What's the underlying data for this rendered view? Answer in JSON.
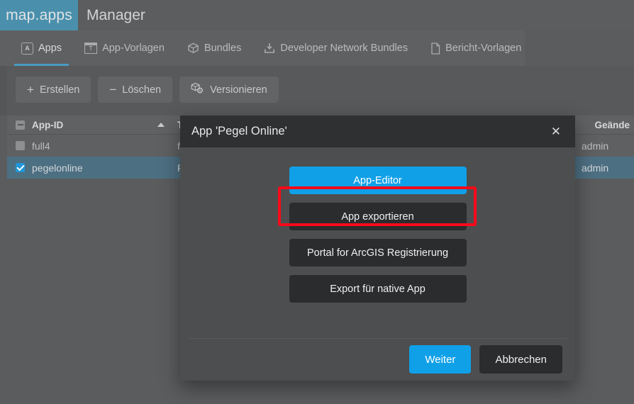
{
  "header": {
    "brand": "map.apps",
    "title": "Manager"
  },
  "tabs": [
    {
      "label": "Apps",
      "icon": "apps-icon",
      "active": true
    },
    {
      "label": "App-Vorlagen",
      "icon": "template-icon",
      "active": false
    },
    {
      "label": "Bundles",
      "icon": "cube-icon",
      "active": false
    },
    {
      "label": "Developer Network Bundles",
      "icon": "download-tray-icon",
      "active": false
    },
    {
      "label": "Bericht-Vorlagen",
      "icon": "document-icon",
      "active": false
    }
  ],
  "toolbar": {
    "create_label": "Erstellen",
    "delete_label": "Löschen",
    "version_label": "Versionieren"
  },
  "table": {
    "columns": [
      {
        "key": "id",
        "label": "App-ID",
        "sorted": "asc"
      },
      {
        "key": "title",
        "label": "T"
      },
      {
        "key": "modified_by",
        "label": "Geände"
      }
    ],
    "rows": [
      {
        "selected": false,
        "id": "full4",
        "title": "f",
        "modified_by": "admin"
      },
      {
        "selected": true,
        "id": "pegelonline",
        "title": "P",
        "modified_by": "admin"
      }
    ]
  },
  "dialog": {
    "title": "App 'Pegel Online'",
    "close_icon": "✕",
    "actions": [
      {
        "label": "App-Editor",
        "primary": true,
        "highlighted": true
      },
      {
        "label": "App exportieren",
        "primary": false,
        "highlighted": false
      },
      {
        "label": "Portal for ArcGIS Registrierung",
        "primary": false,
        "highlighted": false
      },
      {
        "label": "Export für native App",
        "primary": false,
        "highlighted": false
      }
    ],
    "footer": {
      "confirm_label": "Weiter",
      "cancel_label": "Abbrechen"
    }
  },
  "colors": {
    "brand_blue": "#4a90ad",
    "accent_blue": "#10a0e8",
    "highlight_red": "#f9091a",
    "row_selected": "#4d6f82"
  }
}
